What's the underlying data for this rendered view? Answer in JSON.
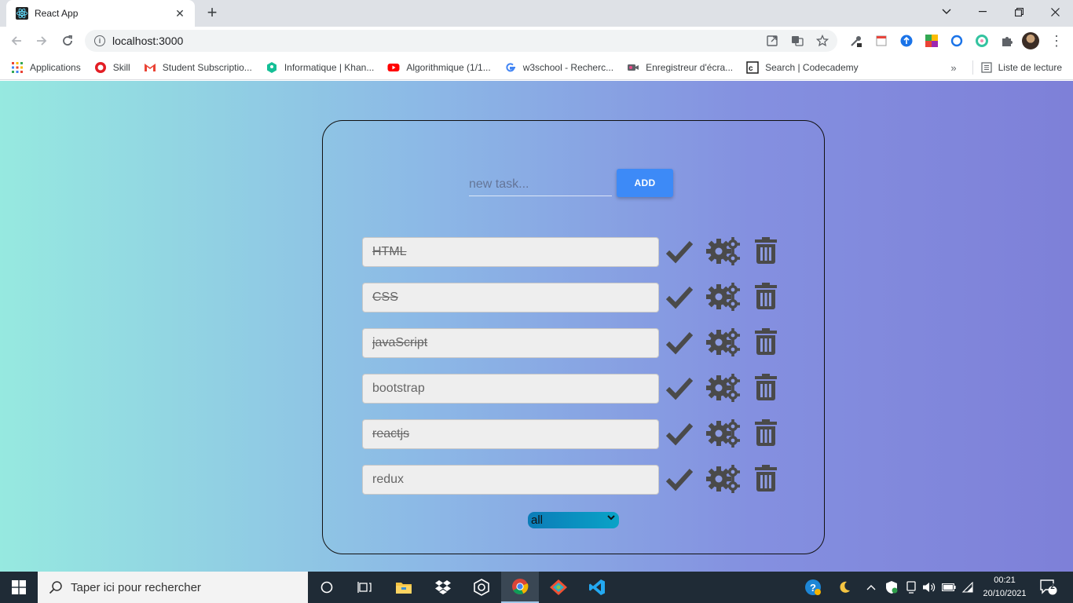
{
  "browser": {
    "tab_title": "React App",
    "url": "localhost:3000",
    "bookmarks": [
      {
        "label": "Applications",
        "icon": "apps-grid-icon"
      },
      {
        "label": "Skill",
        "icon": "skill-icon"
      },
      {
        "label": "Student Subscriptio...",
        "icon": "gmail-icon"
      },
      {
        "label": "Informatique | Khan...",
        "icon": "khan-academy-icon"
      },
      {
        "label": "Algorithmique (1/1...",
        "icon": "youtube-icon"
      },
      {
        "label": "w3school - Recherc...",
        "icon": "google-icon"
      },
      {
        "label": "Enregistreur d'écra...",
        "icon": "screen-recorder-icon"
      },
      {
        "label": "Search | Codecademy",
        "icon": "codecademy-icon"
      }
    ],
    "reading_list": "Liste de lecture"
  },
  "app": {
    "new_task_placeholder": "new task...",
    "add_label": "ADD",
    "tasks": [
      {
        "text": "HTML",
        "done": true
      },
      {
        "text": "CSS",
        "done": true
      },
      {
        "text": "javaScript",
        "done": true
      },
      {
        "text": "bootstrap",
        "done": false
      },
      {
        "text": "reactjs",
        "done": true
      },
      {
        "text": "redux",
        "done": false
      }
    ],
    "filter_value": "all"
  },
  "taskbar": {
    "search_placeholder": "Taper ici pour rechercher",
    "time": "00:21",
    "date": "20/10/2021",
    "notification_count": "2"
  },
  "colors": {
    "add_button": "#3d8af7",
    "task_icons": "#4a4a4a",
    "gradient_start": "#96e9e0",
    "gradient_end": "#7e80d8"
  }
}
